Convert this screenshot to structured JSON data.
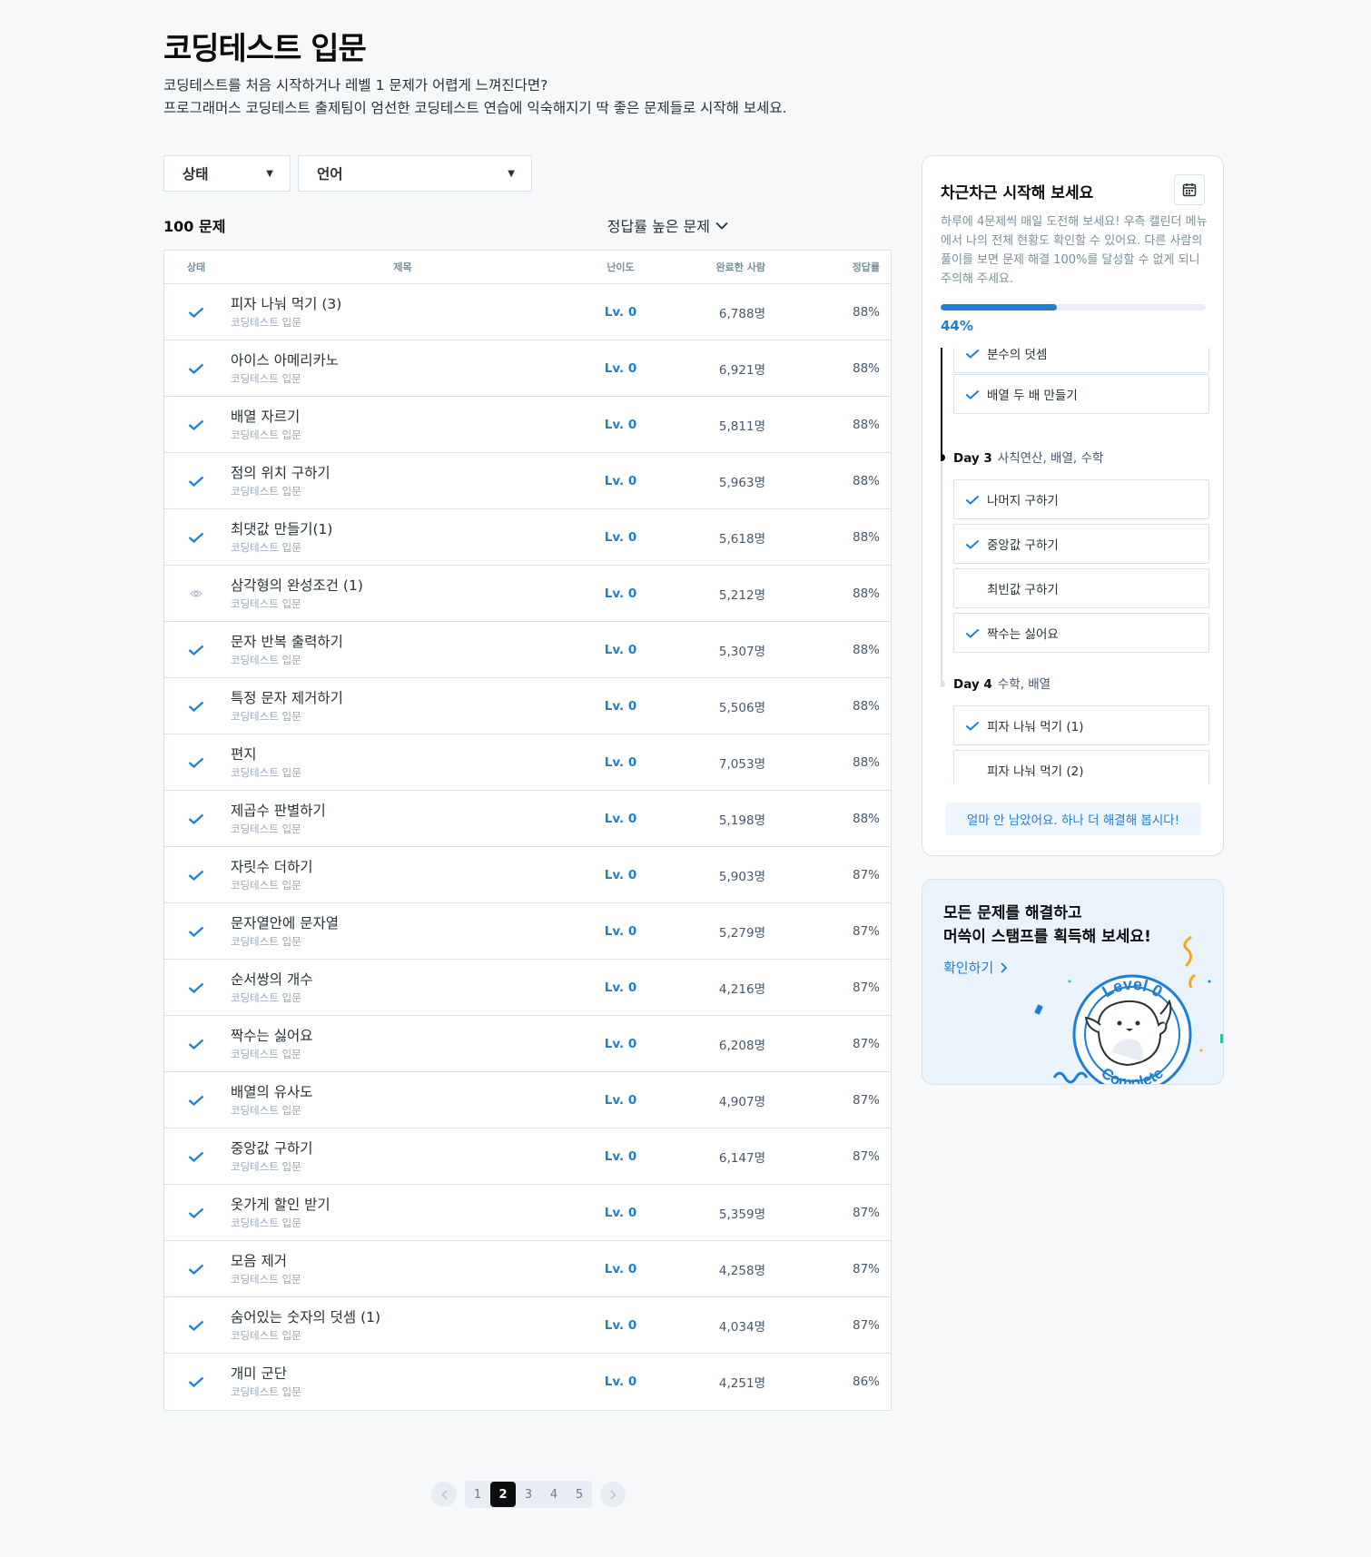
{
  "header": {
    "title": "코딩테스트 입문",
    "desc_line1": "코딩테스트를 처음 시작하거나 레벨 1 문제가 어렵게 느껴진다면?",
    "desc_line2": "프로그래머스 코딩테스트 출제팀이 엄선한 코딩테스트 연습에 익숙해지기 딱 좋은 문제들로 시작해 보세요."
  },
  "filters": {
    "status_label": "상태",
    "language_label": "언어",
    "caret": "▼"
  },
  "list": {
    "count_label": "100 문제",
    "sort_label": "정답률 높은 문제",
    "columns": {
      "status": "상태",
      "title": "제목",
      "level": "난이도",
      "done": "완료한 사람",
      "rate": "정답률"
    },
    "rows": [
      {
        "status": "solved",
        "title": "피자 나눠 먹기 (3)",
        "category": "코딩테스트 입문",
        "level": "Lv. 0",
        "done": "6,788명",
        "rate": "88%"
      },
      {
        "status": "solved",
        "title": "아이스 아메리카노",
        "category": "코딩테스트 입문",
        "level": "Lv. 0",
        "done": "6,921명",
        "rate": "88%"
      },
      {
        "status": "solved",
        "title": "배열 자르기",
        "category": "코딩테스트 입문",
        "level": "Lv. 0",
        "done": "5,811명",
        "rate": "88%"
      },
      {
        "status": "solved",
        "title": "점의 위치 구하기",
        "category": "코딩테스트 입문",
        "level": "Lv. 0",
        "done": "5,963명",
        "rate": "88%"
      },
      {
        "status": "solved",
        "title": "최댓값 만들기(1)",
        "category": "코딩테스트 입문",
        "level": "Lv. 0",
        "done": "5,618명",
        "rate": "88%"
      },
      {
        "status": "viewed",
        "title": "삼각형의 완성조건 (1)",
        "category": "코딩테스트 입문",
        "level": "Lv. 0",
        "done": "5,212명",
        "rate": "88%"
      },
      {
        "status": "solved",
        "title": "문자 반복 출력하기",
        "category": "코딩테스트 입문",
        "level": "Lv. 0",
        "done": "5,307명",
        "rate": "88%"
      },
      {
        "status": "solved",
        "title": "특정 문자 제거하기",
        "category": "코딩테스트 입문",
        "level": "Lv. 0",
        "done": "5,506명",
        "rate": "88%"
      },
      {
        "status": "solved",
        "title": "편지",
        "category": "코딩테스트 입문",
        "level": "Lv. 0",
        "done": "7,053명",
        "rate": "88%"
      },
      {
        "status": "solved",
        "title": "제곱수 판별하기",
        "category": "코딩테스트 입문",
        "level": "Lv. 0",
        "done": "5,198명",
        "rate": "88%"
      },
      {
        "status": "solved",
        "title": "자릿수 더하기",
        "category": "코딩테스트 입문",
        "level": "Lv. 0",
        "done": "5,903명",
        "rate": "87%"
      },
      {
        "status": "solved",
        "title": "문자열안에 문자열",
        "category": "코딩테스트 입문",
        "level": "Lv. 0",
        "done": "5,279명",
        "rate": "87%"
      },
      {
        "status": "solved",
        "title": "순서쌍의 개수",
        "category": "코딩테스트 입문",
        "level": "Lv. 0",
        "done": "4,216명",
        "rate": "87%"
      },
      {
        "status": "solved",
        "title": "짝수는 싫어요",
        "category": "코딩테스트 입문",
        "level": "Lv. 0",
        "done": "6,208명",
        "rate": "87%"
      },
      {
        "status": "solved",
        "title": "배열의 유사도",
        "category": "코딩테스트 입문",
        "level": "Lv. 0",
        "done": "4,907명",
        "rate": "87%"
      },
      {
        "status": "solved",
        "title": "중앙값 구하기",
        "category": "코딩테스트 입문",
        "level": "Lv. 0",
        "done": "6,147명",
        "rate": "87%"
      },
      {
        "status": "solved",
        "title": "옷가게 할인 받기",
        "category": "코딩테스트 입문",
        "level": "Lv. 0",
        "done": "5,359명",
        "rate": "87%"
      },
      {
        "status": "solved",
        "title": "모음 제거",
        "category": "코딩테스트 입문",
        "level": "Lv. 0",
        "done": "4,258명",
        "rate": "87%"
      },
      {
        "status": "solved",
        "title": "숨어있는 숫자의 덧셈 (1)",
        "category": "코딩테스트 입문",
        "level": "Lv. 0",
        "done": "4,034명",
        "rate": "87%"
      },
      {
        "status": "solved",
        "title": "개미 군단",
        "category": "코딩테스트 입문",
        "level": "Lv. 0",
        "done": "4,251명",
        "rate": "86%"
      }
    ]
  },
  "pagination": {
    "pages": [
      "1",
      "2",
      "3",
      "4",
      "5"
    ],
    "current": "2",
    "prev": "‹",
    "next": "›"
  },
  "sidebar": {
    "title": "차근차근 시작해 보세요",
    "desc": "하루에 4문제씩 매일 도전해 보세요! 우측 캘린더 메뉴에서 나의 전체 현황도 확인할 수 있어요. 다른 사람의 풀이를 보면 문제 해결 100%를 달성할 수 없게 되니 주의해 주세요.",
    "progress_value": 0.44,
    "progress_label": "44%",
    "timeline_items_top": [
      {
        "title": "분수의 덧셈",
        "solved": true
      },
      {
        "title": "배열 두 배 만들기",
        "solved": true
      }
    ],
    "day3": {
      "label": "Day 3",
      "topic": "사칙연산, 배열, 수학"
    },
    "day3_items": [
      {
        "title": "나머지 구하기",
        "solved": true
      },
      {
        "title": "중앙값 구하기",
        "solved": true
      },
      {
        "title": "최빈값 구하기",
        "solved": false
      },
      {
        "title": "짝수는 싫어요",
        "solved": true
      }
    ],
    "day4": {
      "label": "Day 4",
      "topic": "수학, 배열"
    },
    "day4_items": [
      {
        "title": "피자 나눠 먹기 (1)",
        "solved": true
      },
      {
        "title": "피자 나눠 먹기 (2)",
        "solved": false
      }
    ],
    "encourage_label": "얼마 안 남았어요. 하나 더 해결해 봅시다!"
  },
  "stamp": {
    "title_line1": "모든 문제를 해결하고",
    "title_line2": "머쓱이 스탬프를 획득해 보세요!",
    "link_label": "확인하기",
    "stamp_top_text": "Level 0",
    "stamp_bottom_text": "Complete"
  },
  "colors": {
    "accent": "#1c7ed6",
    "border": "#d7e2eb",
    "text": "#263238",
    "muted": "#98a8b9"
  }
}
